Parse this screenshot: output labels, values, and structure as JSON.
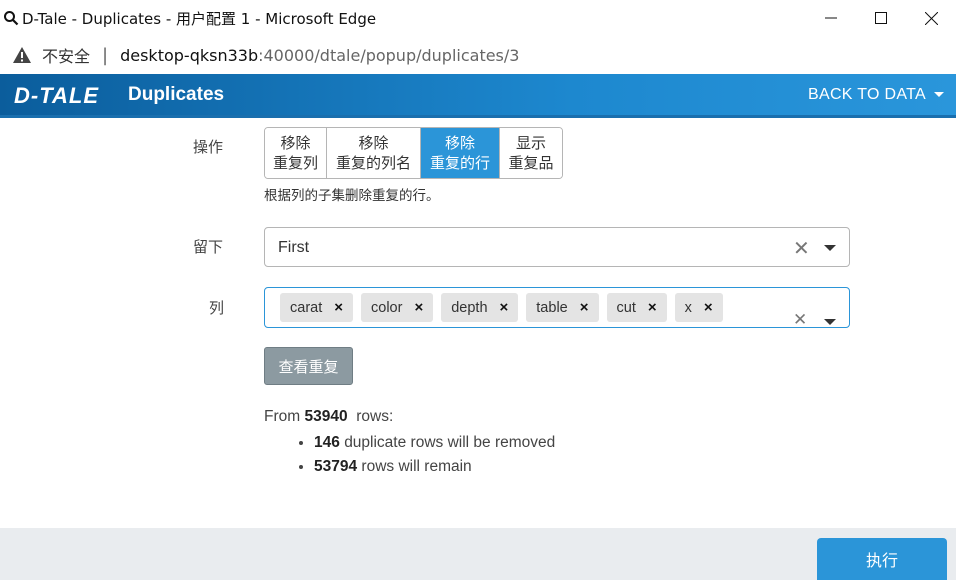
{
  "window": {
    "title": "D-Tale - Duplicates - 用户配置 1 - Microsoft Edge"
  },
  "address_bar": {
    "security_label": "不安全",
    "separator": "|",
    "host": "desktop-qksn33b",
    "path": ":40000/dtale/popup/duplicates/3"
  },
  "header": {
    "logo_text": "D-TALE",
    "title": "Duplicates",
    "back_label": "BACK TO DATA"
  },
  "form": {
    "operation_label": "操作",
    "operations": [
      {
        "line1": "移除",
        "line2": "重复列",
        "active": false
      },
      {
        "line1": "移除",
        "line2": "重复的列名",
        "active": false
      },
      {
        "line1": "移除",
        "line2": "重复的行",
        "active": true
      },
      {
        "line1": "显示",
        "line2": "重复品",
        "active": false
      }
    ],
    "operation_hint": "根据列的子集删除重复的行。",
    "keep_label": "留下",
    "keep_value": "First",
    "columns_label": "列",
    "columns": [
      "carat",
      "color",
      "depth",
      "table",
      "cut",
      "x"
    ],
    "view_button": "查看重复"
  },
  "summary": {
    "from_prefix": "From",
    "total_rows": "53940",
    "rows_suffix": "rows:",
    "removed_count": "146",
    "removed_text": "duplicate rows will be removed",
    "remain_count": "53794",
    "remain_text": "rows will remain"
  },
  "footer": {
    "execute_button": "执行"
  },
  "colors": {
    "accent": "#2b95d8",
    "header_dark": "#0b5d9c",
    "view_button": "#8c9aa1"
  }
}
